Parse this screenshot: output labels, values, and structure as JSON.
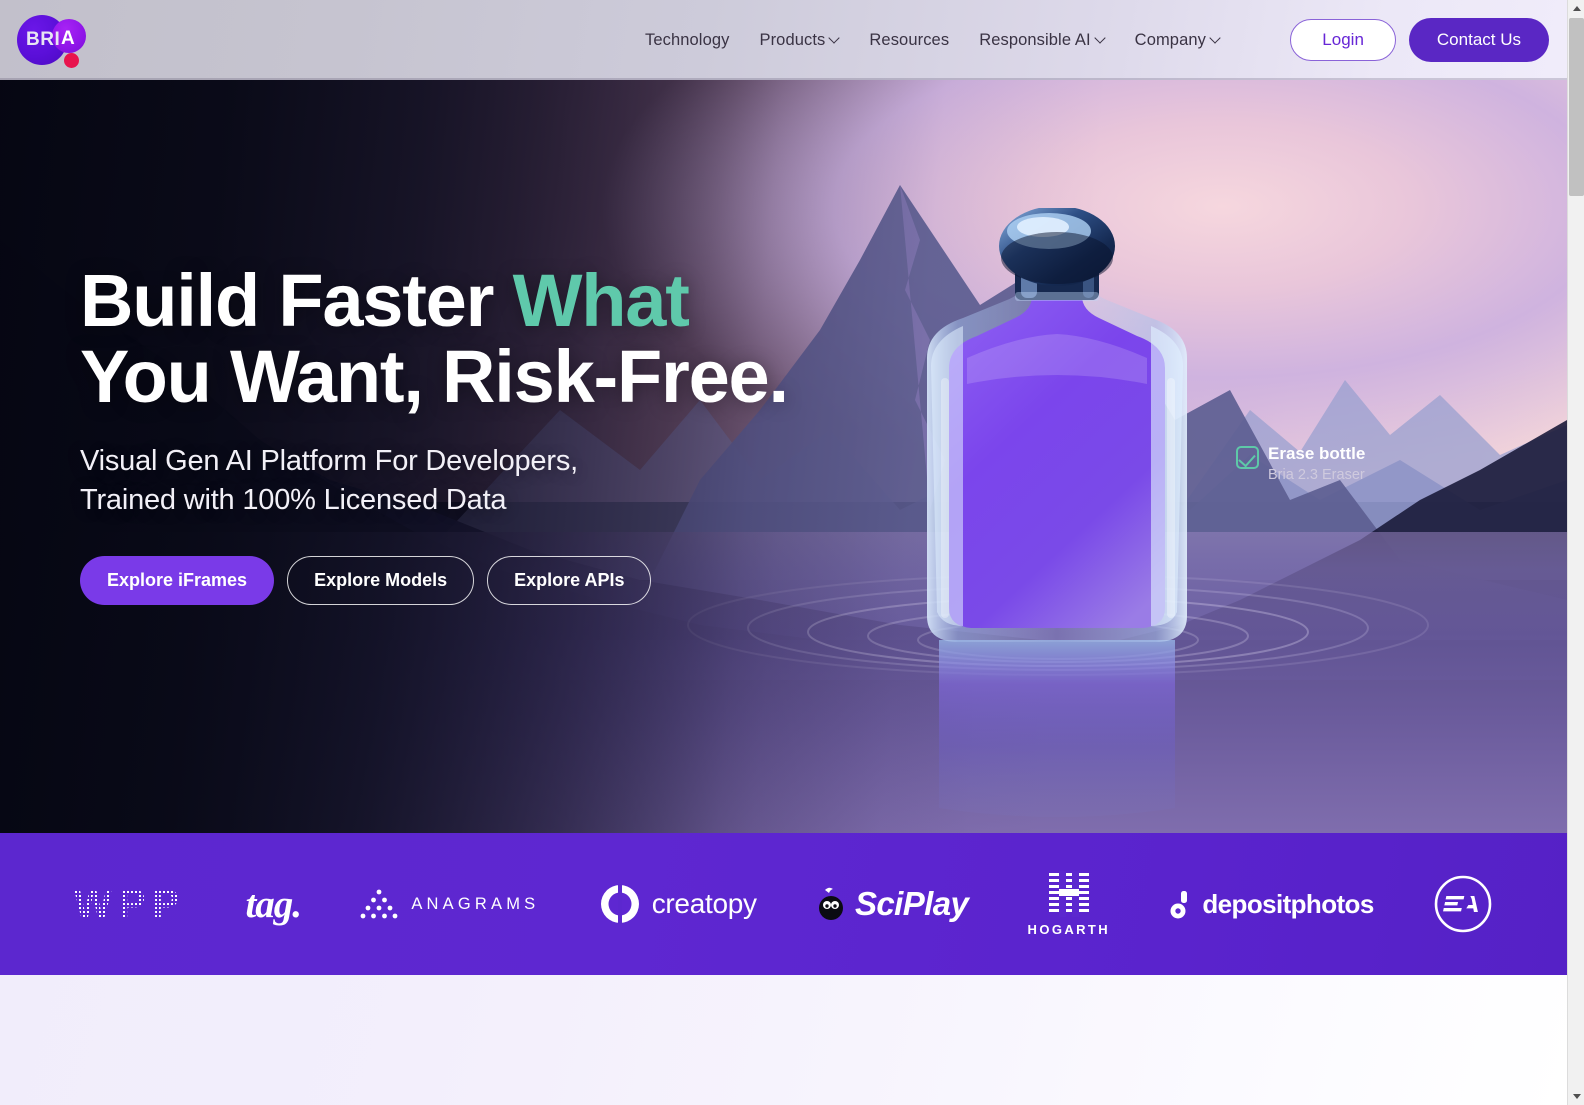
{
  "brand": {
    "logo_text_primary": "BRI",
    "logo_text_secondary": "A",
    "accent_purple": "#5a27c4",
    "accent_teal": "#5fc9ab",
    "logo_dot_color": "#e8144e"
  },
  "nav": {
    "items": [
      {
        "label": "Technology",
        "has_dropdown": false
      },
      {
        "label": "Products",
        "has_dropdown": true
      },
      {
        "label": "Resources",
        "has_dropdown": false
      },
      {
        "label": "Responsible AI",
        "has_dropdown": true
      },
      {
        "label": "Company",
        "has_dropdown": true
      }
    ],
    "login_label": "Login",
    "contact_label": "Contact Us"
  },
  "hero": {
    "headline_line1_a": "Build Faster ",
    "headline_line1_accent": "What",
    "headline_line2": "You Want, Risk-Free.",
    "subhead_line1": "Visual Gen AI Platform For Developers,",
    "subhead_line2": "Trained with 100% Licensed Data",
    "buttons": [
      {
        "label": "Explore iFrames",
        "style": "filled"
      },
      {
        "label": "Explore Models",
        "style": "outline"
      },
      {
        "label": "Explore APIs",
        "style": "outline"
      }
    ],
    "annotation": {
      "title": "Erase bottle",
      "subtitle": "Bria 2.3 Eraser",
      "checkbox_state": "checked"
    }
  },
  "logo_bar": {
    "background_color": "#5c27cf",
    "logos": [
      {
        "name": "WPP",
        "label": "WPP"
      },
      {
        "name": "tag",
        "label": "tag."
      },
      {
        "name": "Anagrams",
        "label": "ANAGRAMS"
      },
      {
        "name": "Creatopy",
        "label": "creatopy"
      },
      {
        "name": "SciPlay",
        "label": "SciPlay"
      },
      {
        "name": "Hogarth",
        "label": "HOGARTH"
      },
      {
        "name": "Depositphotos",
        "label": "depositphotos"
      },
      {
        "name": "EA",
        "label": "EA"
      }
    ]
  }
}
